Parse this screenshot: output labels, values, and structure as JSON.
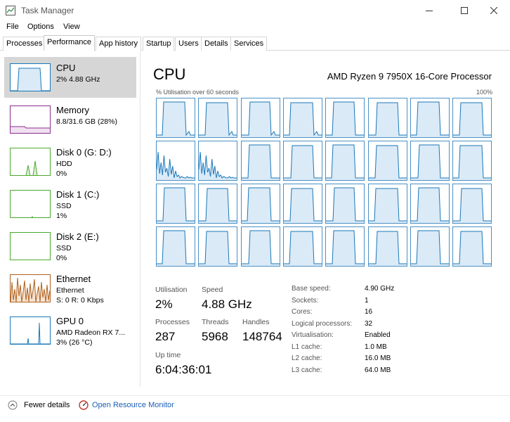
{
  "window": {
    "title": "Task Manager",
    "icons": {
      "app": "task-manager-icon",
      "minimize": "minimize-icon",
      "maximize": "maximize-icon",
      "close": "close-icon"
    }
  },
  "menu": [
    "File",
    "Options",
    "View"
  ],
  "tabs": [
    "Processes",
    "Performance",
    "App history",
    "Startup",
    "Users",
    "Details",
    "Services"
  ],
  "active_tab": "Performance",
  "sidebar": [
    {
      "name": "CPU",
      "line1": "2% 4.88 GHz",
      "line2": "",
      "color": "#1a78b8",
      "selected": true
    },
    {
      "name": "Memory",
      "line1": "8.8/31.6 GB (28%)",
      "line2": "",
      "color": "#8b2f8b",
      "selected": false
    },
    {
      "name": "Disk 0 (G: D:)",
      "line1": "HDD",
      "line2": "0%",
      "color": "#4ca82e",
      "selected": false
    },
    {
      "name": "Disk 1 (C:)",
      "line1": "SSD",
      "line2": "1%",
      "color": "#4ca82e",
      "selected": false
    },
    {
      "name": "Disk 2 (E:)",
      "line1": "SSD",
      "line2": "0%",
      "color": "#4ca82e",
      "selected": false
    },
    {
      "name": "Ethernet",
      "line1": "Ethernet",
      "line2": "S: 0 R: 0 Kbps",
      "color": "#b0601c",
      "selected": false
    },
    {
      "name": "GPU 0",
      "line1": "AMD Radeon RX 7...",
      "line2": "3% (26 °C)",
      "color": "#1a78b8",
      "selected": false
    }
  ],
  "main": {
    "title": "CPU",
    "model": "AMD Ryzen 9 7950X 16-Core Processor",
    "graph_label": "% Utilisation over 60 seconds",
    "graph_max": "100%",
    "core_graphs": {
      "rows": 4,
      "cols": 8,
      "line_color": "#1a78b8",
      "fill_color": "#dbeaf7"
    }
  },
  "stats": {
    "utilisation_label": "Utilisation",
    "utilisation": "2%",
    "speed_label": "Speed",
    "speed": "4.88 GHz",
    "processes_label": "Processes",
    "processes": "287",
    "threads_label": "Threads",
    "threads": "5968",
    "handles_label": "Handles",
    "handles": "148764",
    "uptime_label": "Up time",
    "uptime": "6:04:36:01"
  },
  "specs": [
    {
      "label": "Base speed:",
      "value": "4.90 GHz"
    },
    {
      "label": "Sockets:",
      "value": "1"
    },
    {
      "label": "Cores:",
      "value": "16"
    },
    {
      "label": "Logical processors:",
      "value": "32"
    },
    {
      "label": "Virtualisation:",
      "value": "Enabled"
    },
    {
      "label": "L1 cache:",
      "value": "1.0 MB"
    },
    {
      "label": "L2 cache:",
      "value": "16.0 MB"
    },
    {
      "label": "L3 cache:",
      "value": "64.0 MB"
    }
  ],
  "footer": {
    "fewer_details": "Fewer details",
    "open_monitor": "Open Resource Monitor",
    "icons": {
      "fewer": "chevron-up-circle-icon",
      "monitor": "resource-monitor-icon"
    }
  }
}
